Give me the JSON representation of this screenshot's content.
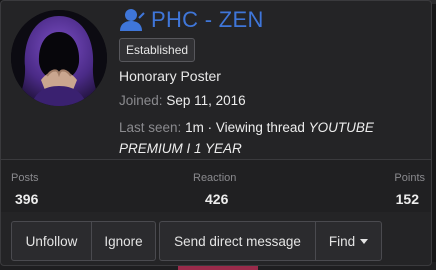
{
  "profile": {
    "username": "PHC - ZEN",
    "badge": "Established",
    "user_title": "Honorary Poster",
    "joined_label": "Joined:",
    "joined_value": "Sep 11, 2016",
    "last_seen_label": "Last seen:",
    "last_seen_time": "1m",
    "last_seen_sep": " · ",
    "last_seen_activity": "Viewing thread",
    "last_seen_thread": "YOUTUBE PREMIUM I 1 YEAR",
    "accent_color": "#3f76d9"
  },
  "stats": {
    "posts_label": "Posts",
    "posts_value": "396",
    "reaction_label": "Reaction",
    "reaction_value": "426",
    "points_label": "Points",
    "points_value": "152"
  },
  "actions": {
    "unfollow": "Unfollow",
    "ignore": "Ignore",
    "message": "Send direct message",
    "find": "Find"
  },
  "icons": {
    "user": "user-icon",
    "caret": "caret-down-icon"
  }
}
